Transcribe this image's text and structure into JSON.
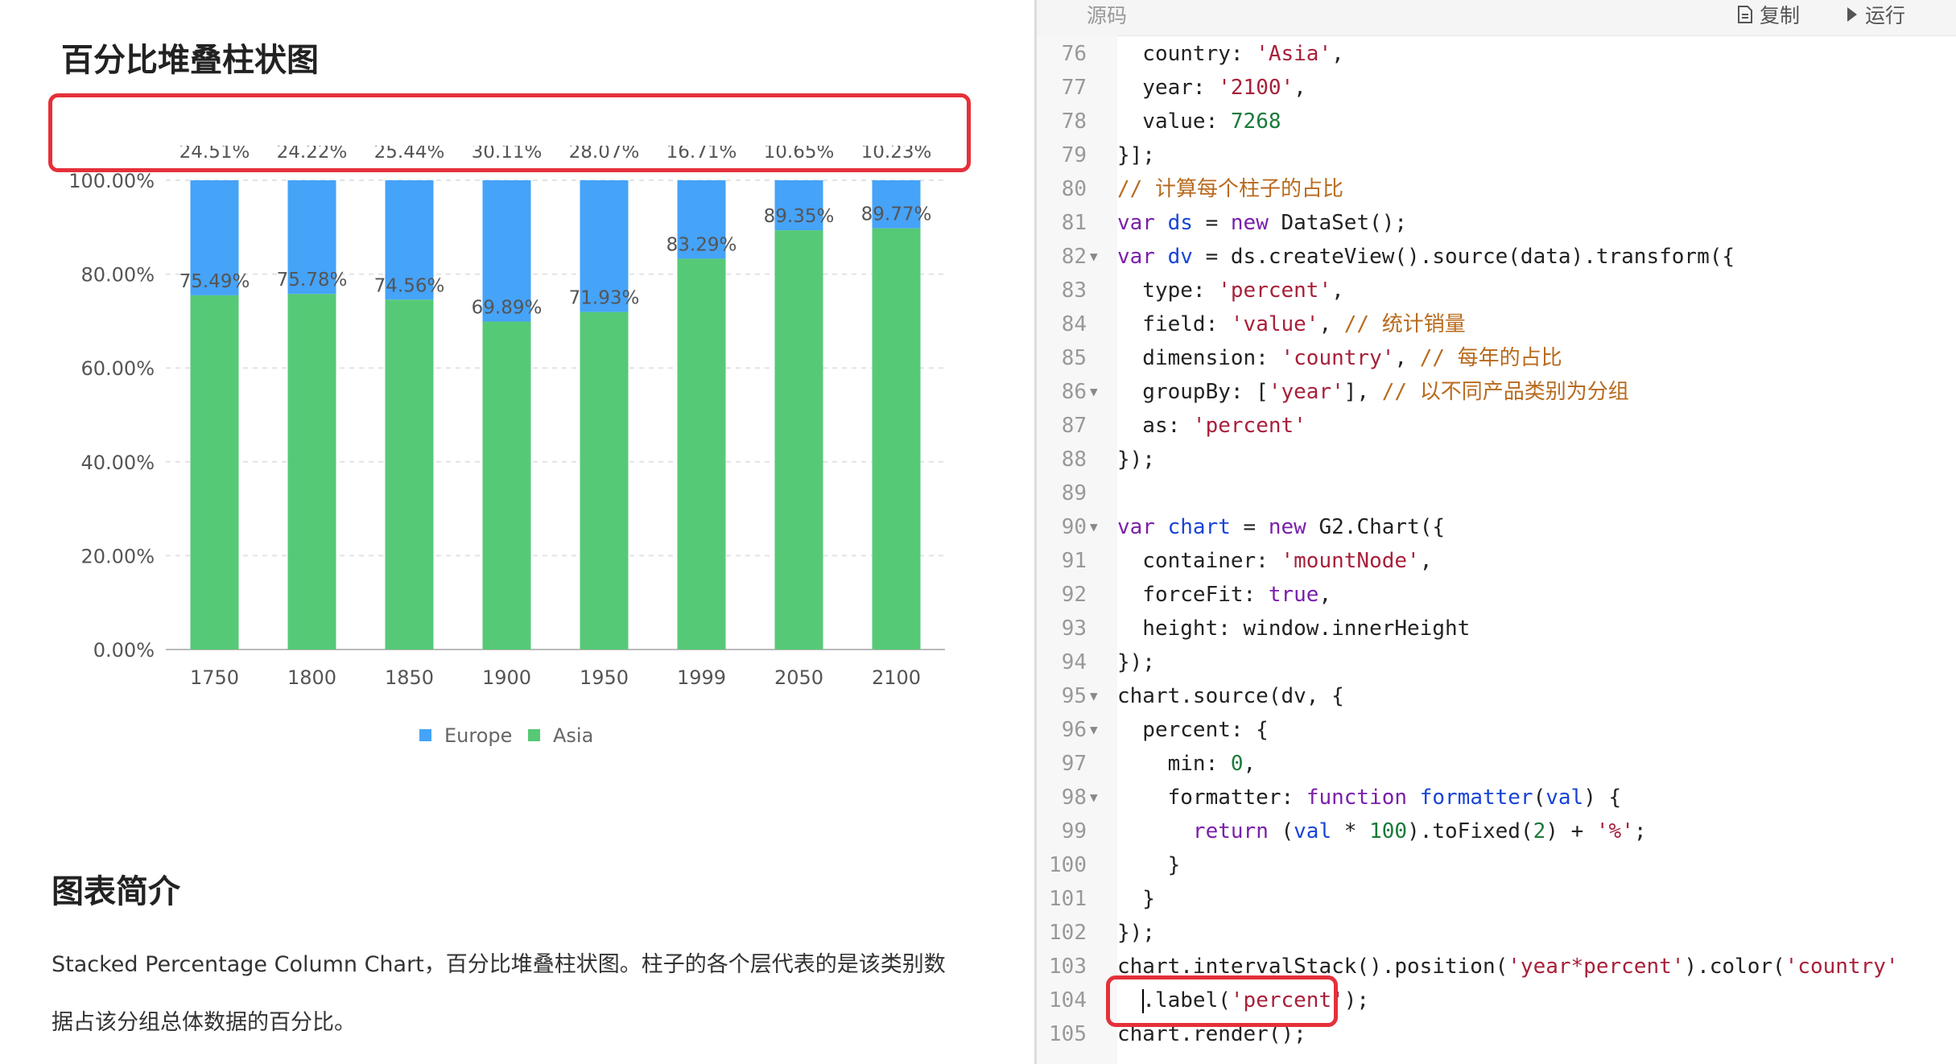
{
  "chart_title": "百分比堆叠柱状图",
  "chart_data": {
    "type": "bar",
    "stacked": true,
    "categories": [
      "1750",
      "1800",
      "1850",
      "1900",
      "1950",
      "1999",
      "2050",
      "2100"
    ],
    "series": [
      {
        "name": "Europe",
        "color": "#45a3f8",
        "values": [
          24.51,
          24.22,
          25.44,
          30.11,
          28.07,
          16.71,
          10.65,
          10.23
        ],
        "labels": [
          "24.51%",
          "24.22%",
          "25.44%",
          "30.11%",
          "28.07%",
          "16.71%",
          "10.65%",
          "10.23%"
        ]
      },
      {
        "name": "Asia",
        "color": "#56c977",
        "values": [
          75.49,
          75.78,
          74.56,
          69.89,
          71.93,
          83.29,
          89.35,
          89.77
        ],
        "labels": [
          "75.49%",
          "75.78%",
          "74.56%",
          "69.89%",
          "71.93%",
          "83.29%",
          "89.35%",
          "89.77%"
        ]
      }
    ],
    "y_ticks": [
      "0.00%",
      "20.00%",
      "40.00%",
      "60.00%",
      "80.00%",
      "100.00%"
    ],
    "ylim": [
      0,
      100
    ],
    "grid": true,
    "legend": "bottom"
  },
  "intro": {
    "title": "图表简介",
    "line1": "Stacked Percentage Column Chart，百分比堆叠柱状图。柱子的各个层代表的是该类别数",
    "line2": "据占该分组总体数据的百分比。"
  },
  "toolbar": {
    "tab": "源码",
    "copy": "复制",
    "run": "运行"
  },
  "code_colors": {
    "keyword": "#7a1faa",
    "string": "#a8203a",
    "comment": "#b86a1e",
    "number": "#1a7a3a",
    "def": "#1844d6",
    "plain": "#222222"
  },
  "code": [
    {
      "n": "76",
      "fold": false,
      "t": [
        [
          "p",
          "  country: "
        ],
        [
          "s",
          "'Asia'"
        ],
        [
          "p",
          ","
        ]
      ]
    },
    {
      "n": "77",
      "fold": false,
      "t": [
        [
          "p",
          "  year: "
        ],
        [
          "s",
          "'2100'"
        ],
        [
          "p",
          ","
        ]
      ]
    },
    {
      "n": "78",
      "fold": false,
      "t": [
        [
          "p",
          "  value: "
        ],
        [
          "n",
          "7268"
        ]
      ]
    },
    {
      "n": "79",
      "fold": false,
      "t": [
        [
          "p",
          "}];"
        ]
      ]
    },
    {
      "n": "80",
      "fold": false,
      "t": [
        [
          "c",
          "// 计算每个柱子的占比"
        ]
      ]
    },
    {
      "n": "81",
      "fold": false,
      "t": [
        [
          "k",
          "var"
        ],
        [
          "p",
          " "
        ],
        [
          "d",
          "ds"
        ],
        [
          "p",
          " = "
        ],
        [
          "k",
          "new"
        ],
        [
          "p",
          " DataSet();"
        ]
      ]
    },
    {
      "n": "82",
      "fold": true,
      "t": [
        [
          "k",
          "var"
        ],
        [
          "p",
          " "
        ],
        [
          "d",
          "dv"
        ],
        [
          "p",
          " = ds.createView().source(data).transform({"
        ]
      ]
    },
    {
      "n": "83",
      "fold": false,
      "t": [
        [
          "p",
          "  type: "
        ],
        [
          "s",
          "'percent'"
        ],
        [
          "p",
          ","
        ]
      ]
    },
    {
      "n": "84",
      "fold": false,
      "t": [
        [
          "p",
          "  field: "
        ],
        [
          "s",
          "'value'"
        ],
        [
          "p",
          ", "
        ],
        [
          "c",
          "// 统计销量"
        ]
      ]
    },
    {
      "n": "85",
      "fold": false,
      "t": [
        [
          "p",
          "  dimension: "
        ],
        [
          "s",
          "'country'"
        ],
        [
          "p",
          ", "
        ],
        [
          "c",
          "// 每年的占比"
        ]
      ]
    },
    {
      "n": "86",
      "fold": true,
      "t": [
        [
          "p",
          "  groupBy: ["
        ],
        [
          "s",
          "'year'"
        ],
        [
          "p",
          "], "
        ],
        [
          "c",
          "// 以不同产品类别为分组"
        ]
      ]
    },
    {
      "n": "87",
      "fold": false,
      "t": [
        [
          "p",
          "  as: "
        ],
        [
          "s",
          "'percent'"
        ]
      ]
    },
    {
      "n": "88",
      "fold": false,
      "t": [
        [
          "p",
          "});"
        ]
      ]
    },
    {
      "n": "89",
      "fold": false,
      "t": []
    },
    {
      "n": "90",
      "fold": true,
      "t": [
        [
          "k",
          "var"
        ],
        [
          "p",
          " "
        ],
        [
          "d",
          "chart"
        ],
        [
          "p",
          " = "
        ],
        [
          "k",
          "new"
        ],
        [
          "p",
          " G2.Chart({"
        ]
      ]
    },
    {
      "n": "91",
      "fold": false,
      "t": [
        [
          "p",
          "  container: "
        ],
        [
          "s",
          "'mountNode'"
        ],
        [
          "p",
          ","
        ]
      ]
    },
    {
      "n": "92",
      "fold": false,
      "t": [
        [
          "p",
          "  forceFit: "
        ],
        [
          "k",
          "true"
        ],
        [
          "p",
          ","
        ]
      ]
    },
    {
      "n": "93",
      "fold": false,
      "t": [
        [
          "p",
          "  height: window.innerHeight"
        ]
      ]
    },
    {
      "n": "94",
      "fold": false,
      "t": [
        [
          "p",
          "});"
        ]
      ]
    },
    {
      "n": "95",
      "fold": true,
      "t": [
        [
          "p",
          "chart.source(dv, {"
        ]
      ]
    },
    {
      "n": "96",
      "fold": true,
      "t": [
        [
          "p",
          "  percent: {"
        ]
      ]
    },
    {
      "n": "97",
      "fold": false,
      "t": [
        [
          "p",
          "    min: "
        ],
        [
          "n",
          "0"
        ],
        [
          "p",
          ","
        ]
      ]
    },
    {
      "n": "98",
      "fold": true,
      "t": [
        [
          "p",
          "    formatter: "
        ],
        [
          "k",
          "function"
        ],
        [
          "p",
          " "
        ],
        [
          "d",
          "formatter"
        ],
        [
          "p",
          "("
        ],
        [
          "d",
          "val"
        ],
        [
          "p",
          ") {"
        ]
      ]
    },
    {
      "n": "99",
      "fold": false,
      "t": [
        [
          "p",
          "      "
        ],
        [
          "k",
          "return"
        ],
        [
          "p",
          " ("
        ],
        [
          "d",
          "val"
        ],
        [
          "p",
          " * "
        ],
        [
          "n",
          "100"
        ],
        [
          "p",
          ").toFixed("
        ],
        [
          "n",
          "2"
        ],
        [
          "p",
          ") + "
        ],
        [
          "s",
          "'%'"
        ],
        [
          "p",
          ";"
        ]
      ]
    },
    {
      "n": "100",
      "fold": false,
      "t": [
        [
          "p",
          "    }"
        ]
      ]
    },
    {
      "n": "101",
      "fold": false,
      "t": [
        [
          "p",
          "  }"
        ]
      ]
    },
    {
      "n": "102",
      "fold": false,
      "t": [
        [
          "p",
          "});"
        ]
      ]
    },
    {
      "n": "103",
      "fold": false,
      "t": [
        [
          "p",
          "chart.intervalStack().position("
        ],
        [
          "s",
          "'year*percent'"
        ],
        [
          "p",
          ").color("
        ],
        [
          "s",
          "'country'"
        ]
      ]
    },
    {
      "n": "104",
      "fold": false,
      "cursor": true,
      "t": [
        [
          "p",
          "  .label("
        ],
        [
          "s",
          "'percent'"
        ],
        [
          "p",
          ");"
        ]
      ]
    },
    {
      "n": "105",
      "fold": false,
      "t": [
        [
          "p",
          "chart.render();"
        ]
      ]
    }
  ]
}
